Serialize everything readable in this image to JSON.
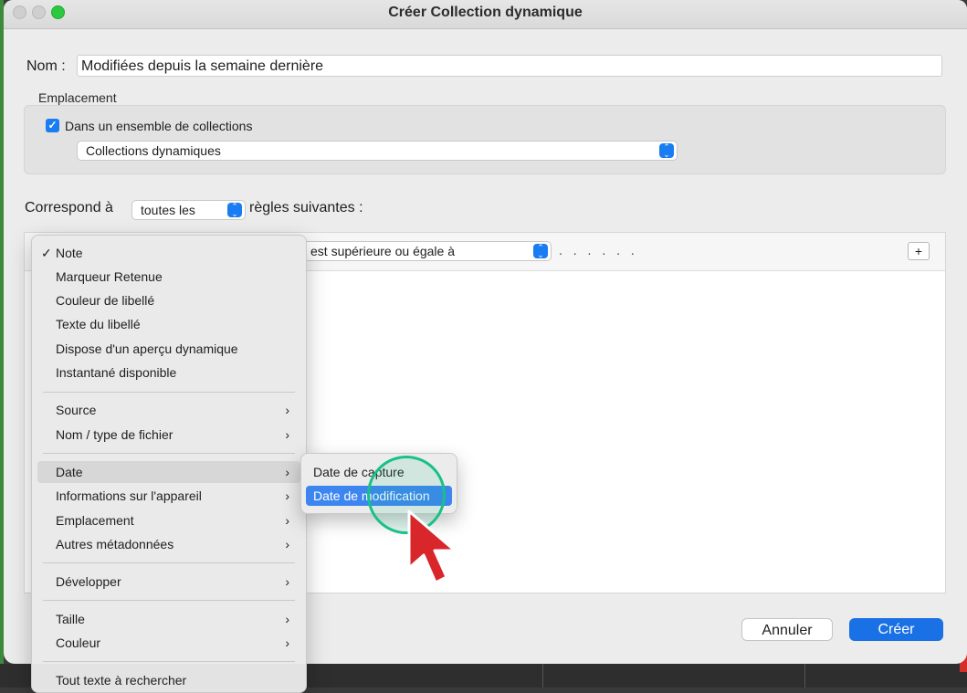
{
  "dialog": {
    "title": "Créer Collection dynamique",
    "name_label": "Nom :",
    "name_value": "Modifiées depuis la semaine dernière",
    "location_label": "Emplacement",
    "in_set_label": "Dans un ensemble de collections",
    "in_set_checked": true,
    "collection_set": "Collections dynamiques",
    "match_prefix": "Correspond à",
    "match_value": "toutes les",
    "match_suffix": "règles suivantes :",
    "rule_operator": "est supérieure ou égale à",
    "rule_value": ". . . . . .",
    "add_rule": "+",
    "cancel_label": "Annuler",
    "create_label": "Créer"
  },
  "menu": {
    "items": [
      {
        "label": "Note",
        "checked": true
      },
      {
        "label": "Marqueur Retenue"
      },
      {
        "label": "Couleur de libellé"
      },
      {
        "label": "Texte du libellé"
      },
      {
        "label": "Dispose d'un aperçu dynamique"
      },
      {
        "label": "Instantané disponible"
      },
      {
        "label": "Source",
        "submenu": true
      },
      {
        "label": "Nom / type de fichier",
        "submenu": true
      },
      {
        "label": "Date",
        "submenu": true,
        "active": true
      },
      {
        "label": "Informations sur l'appareil",
        "submenu": true
      },
      {
        "label": "Emplacement",
        "submenu": true
      },
      {
        "label": "Autres métadonnées",
        "submenu": true
      },
      {
        "label": "Développer",
        "submenu": true
      },
      {
        "label": "Taille",
        "submenu": true
      },
      {
        "label": "Couleur",
        "submenu": true
      },
      {
        "label": "Tout texte à rechercher"
      }
    ],
    "check_glyph": "✓",
    "chevron_glyph": "›"
  },
  "submenu": {
    "items": [
      {
        "label": "Date de capture"
      },
      {
        "label": "Date de modification",
        "highlighted": true
      }
    ]
  },
  "colors": {
    "accent": "#1a70e5",
    "highlight": "#3d86f0",
    "ring": "#18c08a",
    "cursor": "#d9262b"
  },
  "icons": {
    "stepper": "updown-chevron-icon",
    "cursor": "pointer-arrow-icon"
  }
}
